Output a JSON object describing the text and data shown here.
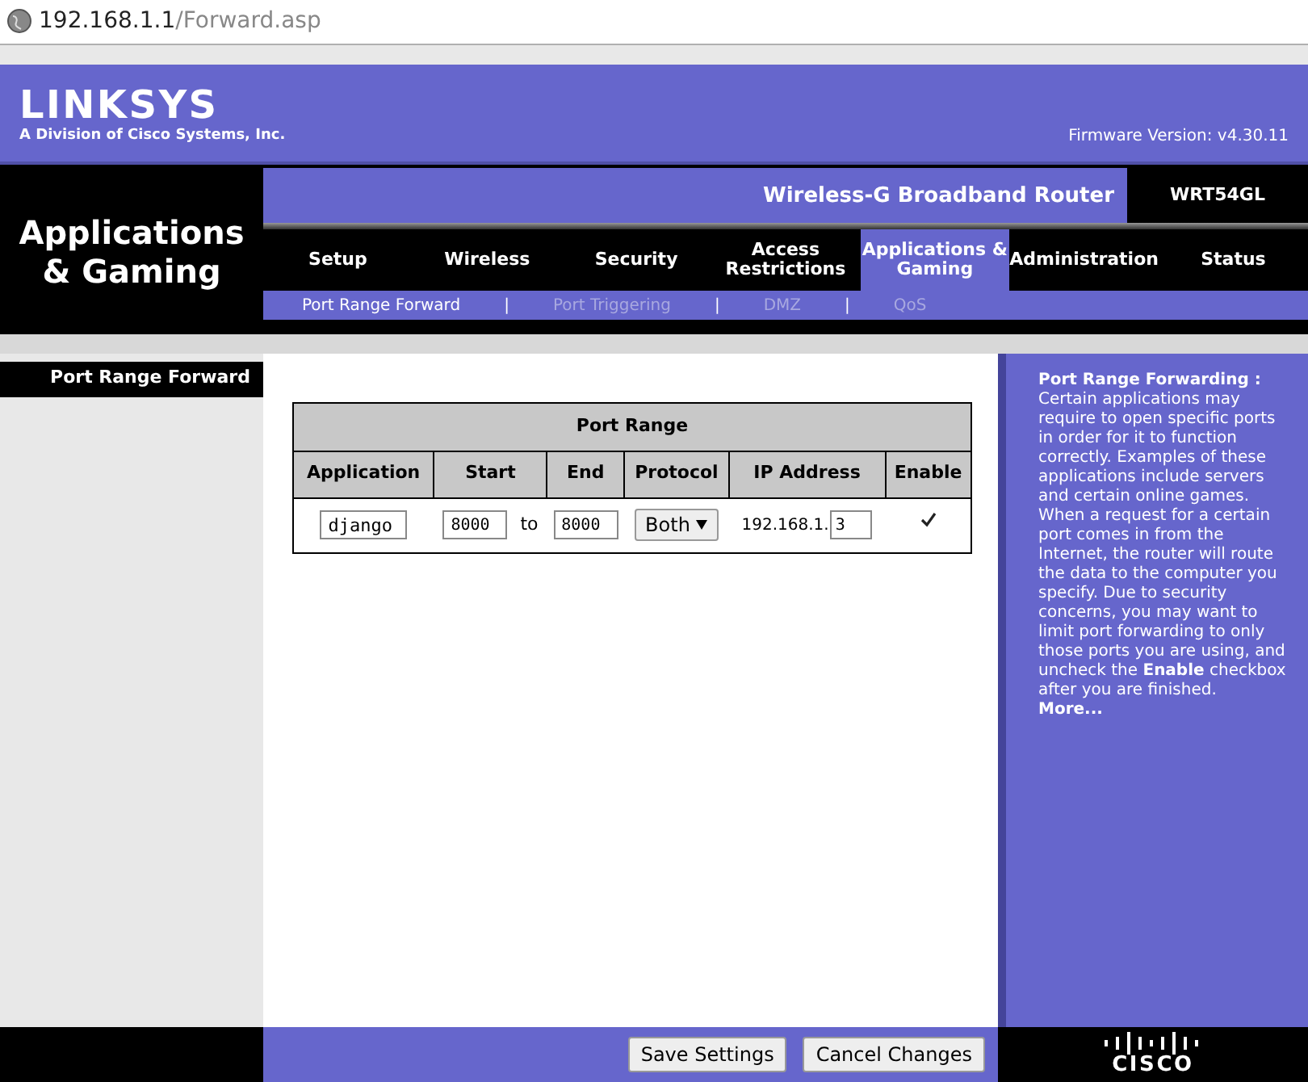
{
  "address_bar": {
    "host": "192.168.1.1",
    "path": "/Forward.asp"
  },
  "header": {
    "logo": "LINKSYS",
    "logo_tagline": "A Division of Cisco Systems, Inc.",
    "firmware": "Firmware Version: v4.30.11"
  },
  "section_title": "Applications & Gaming",
  "product": {
    "name": "Wireless-G Broadband Router",
    "model": "WRT54GL"
  },
  "tabs": [
    {
      "label": "Setup",
      "selected": false
    },
    {
      "label": "Wireless",
      "selected": false
    },
    {
      "label": "Security",
      "selected": false
    },
    {
      "label": "Access Restrictions",
      "selected": false
    },
    {
      "label": "Applications & Gaming",
      "selected": true
    },
    {
      "label": "Administration",
      "selected": false
    },
    {
      "label": "Status",
      "selected": false
    }
  ],
  "subtab_separator": "|",
  "subtabs": [
    {
      "label": "Port Range Forward",
      "selected": true
    },
    {
      "label": "Port Triggering",
      "selected": false
    },
    {
      "label": "DMZ",
      "selected": false
    },
    {
      "label": "QoS",
      "selected": false
    }
  ],
  "sidebar": {
    "label": "Port Range Forward"
  },
  "table": {
    "title": "Port Range",
    "columns": [
      "Application",
      "Start",
      "End",
      "Protocol",
      "IP Address",
      "Enable"
    ],
    "rows": [
      {
        "application": "django",
        "start": "8000",
        "to": "to",
        "end": "8000",
        "protocol": "Both",
        "ip_prefix": "192.168.1.",
        "ip_last": "3",
        "enabled": true
      }
    ]
  },
  "help": {
    "title": "Port Range Forwarding :",
    "text": "Certain applications may require to open specific ports in order for it to function correctly. Examples of these applications include servers and certain online games. When a request for a certain port comes in from the Internet, the router will route the data to the computer you specify. Due to security concerns, you may want to limit port forwarding to only those ports you are using, and uncheck the **Enable** checkbox after you are finished.",
    "more": "More..."
  },
  "buttons": [
    "Save Settings",
    "Cancel Changes"
  ],
  "footer_logo": "CISCO"
}
